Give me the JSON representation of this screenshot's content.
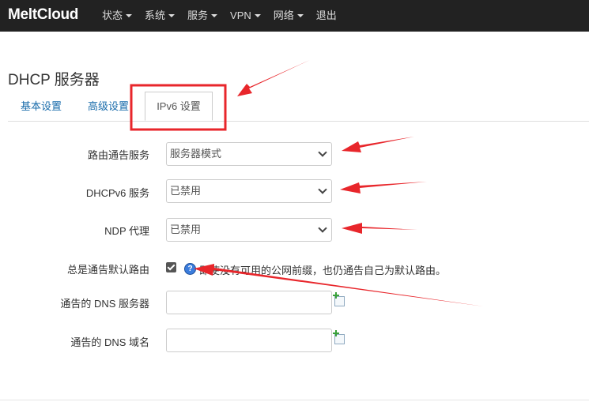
{
  "brand": "MeltCloud",
  "nav": [
    "状态",
    "系统",
    "服务",
    "VPN",
    "网络",
    "退出"
  ],
  "page_title": "DHCP 服务器",
  "tabs": {
    "basic": "基本设置",
    "advanced": "高级设置",
    "ipv6": "IPv6 设置"
  },
  "form": {
    "router_advert": {
      "label": "路由通告服务",
      "value": "服务器模式"
    },
    "dhcpv6": {
      "label": "DHCPv6 服务",
      "value": "已禁用"
    },
    "ndp": {
      "label": "NDP 代理",
      "value": "已禁用"
    },
    "default_route": {
      "label": "总是通告默认路由",
      "help": "即使没有可用的公网前缀，也仍通告自己为默认路由。"
    },
    "dns_server": {
      "label": "通告的 DNS 服务器",
      "value": ""
    },
    "dns_domain": {
      "label": "通告的 DNS 域名",
      "value": ""
    }
  },
  "colors": {
    "navbar": "#222222",
    "link": "#1a6cab",
    "annotation_red": "#e8262b"
  }
}
